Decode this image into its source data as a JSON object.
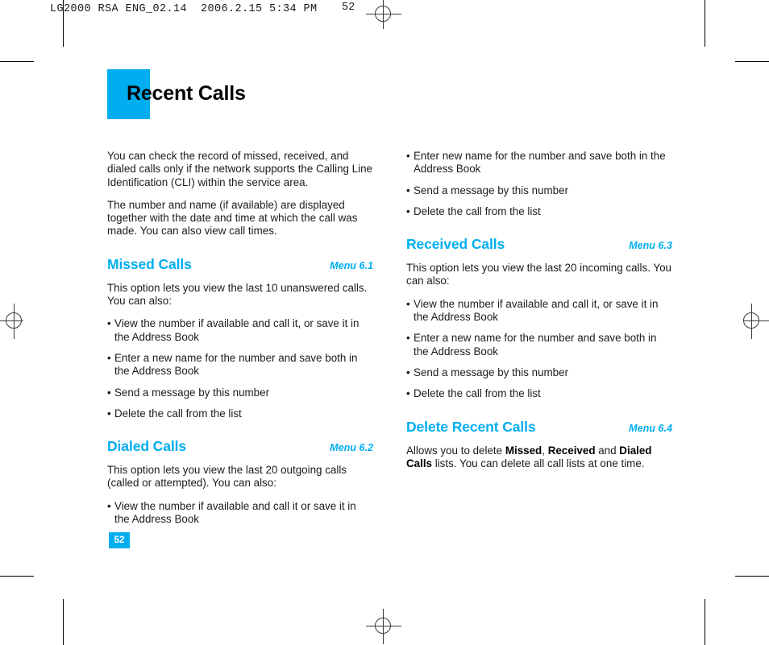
{
  "prepress": {
    "slug": "LG2000 RSA ENG_02.14  2006.2.15 5:34 PM",
    "slug_page": "52"
  },
  "page": {
    "title": "Recent Calls",
    "page_number": "52"
  },
  "left_column": {
    "intro_paragraphs": [
      "You can check the record of missed, received, and dialed calls only if the network supports the Calling Line Identification (CLI) within the service area.",
      "The number and name (if available) are displayed together with the date and time at which the call was made. You can also view call times."
    ],
    "sections": [
      {
        "heading": "Missed Calls",
        "menu_ref": "Menu 6.1",
        "lead": "This option lets you view the last 10 unanswered calls. You can also:",
        "bullets": [
          "View the number if available and call it, or save it in the Address Book",
          "Enter a new name for the number and save both in the Address Book",
          "Send a message by this number",
          "Delete the call from the list"
        ]
      },
      {
        "heading": "Dialed Calls",
        "menu_ref": "Menu 6.2",
        "lead": "This option lets you view the last 20 outgoing calls (called or attempted). You can also:",
        "bullets": [
          "View the number if available and call it or save it in the Address Book"
        ]
      }
    ]
  },
  "right_column": {
    "continued_bullets": [
      "Enter new name for the number and save both in the Address Book",
      "Send a message by this number",
      "Delete the call from the list"
    ],
    "sections": [
      {
        "heading": "Received Calls",
        "menu_ref": "Menu 6.3",
        "lead": "This option lets you view the last 20 incoming calls. You can also:",
        "bullets": [
          "View the number if available and call it, or save it in the Address Book",
          "Enter a new name for the number and save both in the Address Book",
          "Send a message by this number",
          "Delete the call from the list"
        ]
      },
      {
        "heading": "Delete Recent Calls",
        "menu_ref": "Menu 6.4",
        "body_prefix": "Allows you to delete ",
        "body_bold_1": "Missed",
        "body_mid_1": ", ",
        "body_bold_2": "Received",
        "body_mid_2": " and ",
        "body_bold_3": "Dialed Calls",
        "body_suffix": " lists. You can delete all call lists at one time."
      }
    ]
  },
  "bullet_glyph": "•",
  "colors": {
    "accent": "#00AEEF",
    "text": "#1c1c1c"
  }
}
